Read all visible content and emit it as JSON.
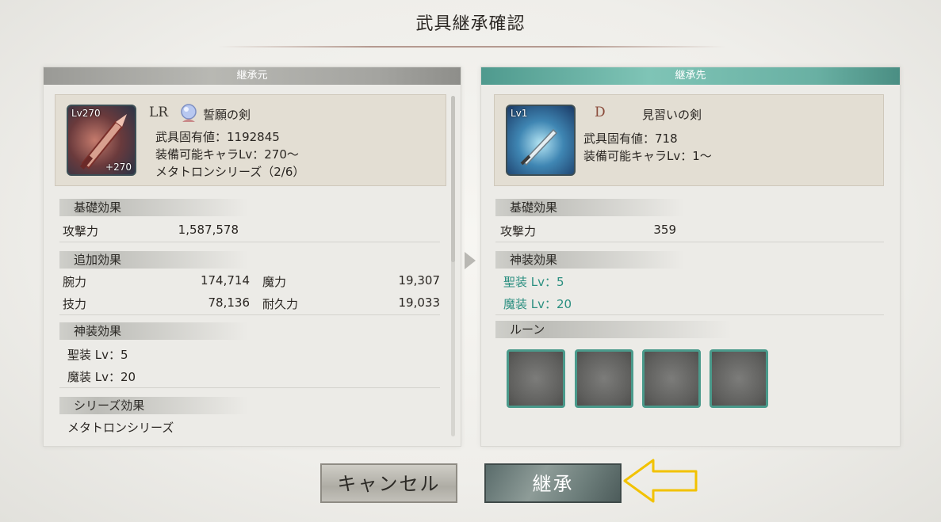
{
  "title": "武具継承確認",
  "source": {
    "header": "継承元",
    "level_badge": "Lv270",
    "plus_badge": "+270",
    "rarity": "LR",
    "weapon_name": "誓願の剣",
    "unique_value": "武具固有値：1192845",
    "equip_level": "装備可能キャラLv：270〜",
    "series": "メタトロンシリーズ（2/6）",
    "basic_effects_label": "基礎効果",
    "attack_label": "攻撃力",
    "attack_value": "1,587,578",
    "extra_effects_label": "追加効果",
    "extra": [
      {
        "label": "腕力",
        "value": "174,714"
      },
      {
        "label": "魔力",
        "value": "19,307"
      },
      {
        "label": "技力",
        "value": "78,136"
      },
      {
        "label": "耐久力",
        "value": "19,033"
      }
    ],
    "divine_label": "神装効果",
    "holy": "聖装 Lv：5",
    "magic": "魔装 Lv：20",
    "series_effect_label": "シリーズ効果",
    "series_effect_value": "メタトロンシリーズ"
  },
  "target": {
    "header": "継承先",
    "level_badge": "Lv1",
    "rarity": "D",
    "weapon_name": "見習いの剣",
    "unique_value": "武具固有値：718",
    "equip_level": "装備可能キャラLv：1〜",
    "basic_effects_label": "基礎効果",
    "attack_label": "攻撃力",
    "attack_value": "359",
    "divine_label": "神装効果",
    "holy": "聖装 Lv：5",
    "magic": "魔装 Lv：20",
    "rune_label": "ルーン"
  },
  "buttons": {
    "cancel": "キャンセル",
    "inherit": "継承"
  },
  "colors": {
    "accent_teal": "#2b8f80",
    "arrow_yellow": "#f2c200"
  }
}
